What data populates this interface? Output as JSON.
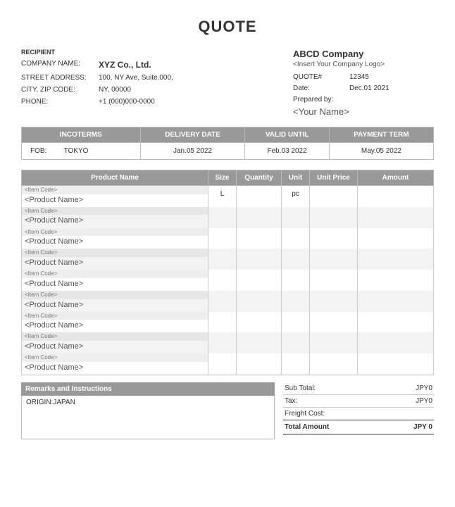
{
  "title": "QUOTE",
  "recipient": {
    "heading": "RECIPIENT",
    "company_label": "COMPANY NAME:",
    "company_value": "XYZ Co., Ltd.",
    "street_label": "STREET ADDRESS:",
    "street_value": "100, NY Ave, Suite.000,",
    "city_label": "CITY, ZIP CODE:",
    "city_value": "NY, 00000",
    "phone_label": "PHONE:",
    "phone_value": "+1 (000)000-0000"
  },
  "sender": {
    "company": "ABCD Company",
    "logo_placeholder": "<Insert Your Company Logo>",
    "quote_label": "QUOTE#",
    "quote_value": "12345",
    "date_label": "Date:",
    "date_value": "Dec.01 2021",
    "prepared_label": "Prepared by:",
    "prepared_value": "<Your Name>"
  },
  "terms": {
    "headers": [
      "INCOTERMS",
      "DELIVERY DATE",
      "VALID UNTIL",
      "PAYMENT TERM"
    ],
    "incoterms_prefix": "FOB:",
    "incoterms_value": "TOKYO",
    "delivery": "Jan.05 2022",
    "valid": "Feb.03 2022",
    "payment": "May.05 2022"
  },
  "products": {
    "headers": [
      "Product Name",
      "Size",
      "Quantity",
      "Unit",
      "Unit Price",
      "Amount"
    ],
    "item_code_placeholder": "<Item Code>",
    "product_name_placeholder": "<Product Name>",
    "rows": [
      {
        "size": "L",
        "qty": "",
        "unit": "pc",
        "price": "",
        "amount": ""
      },
      {
        "size": "",
        "qty": "",
        "unit": "",
        "price": "",
        "amount": ""
      },
      {
        "size": "",
        "qty": "",
        "unit": "",
        "price": "",
        "amount": ""
      },
      {
        "size": "",
        "qty": "",
        "unit": "",
        "price": "",
        "amount": ""
      },
      {
        "size": "",
        "qty": "",
        "unit": "",
        "price": "",
        "amount": ""
      },
      {
        "size": "",
        "qty": "",
        "unit": "",
        "price": "",
        "amount": ""
      },
      {
        "size": "",
        "qty": "",
        "unit": "",
        "price": "",
        "amount": ""
      },
      {
        "size": "",
        "qty": "",
        "unit": "",
        "price": "",
        "amount": ""
      },
      {
        "size": "",
        "qty": "",
        "unit": "",
        "price": "",
        "amount": ""
      }
    ]
  },
  "remarks": {
    "header": "Remarks and Instructions",
    "body": "ORIGIN:JAPAN"
  },
  "totals": {
    "subtotal_label": "Sub Total:",
    "subtotal_value": "JPY0",
    "tax_label": "Tax:",
    "tax_value": "JPY0",
    "freight_label": "Freight Cost:",
    "freight_value": "",
    "total_label": "Total Amount",
    "total_value": "JPY 0"
  }
}
